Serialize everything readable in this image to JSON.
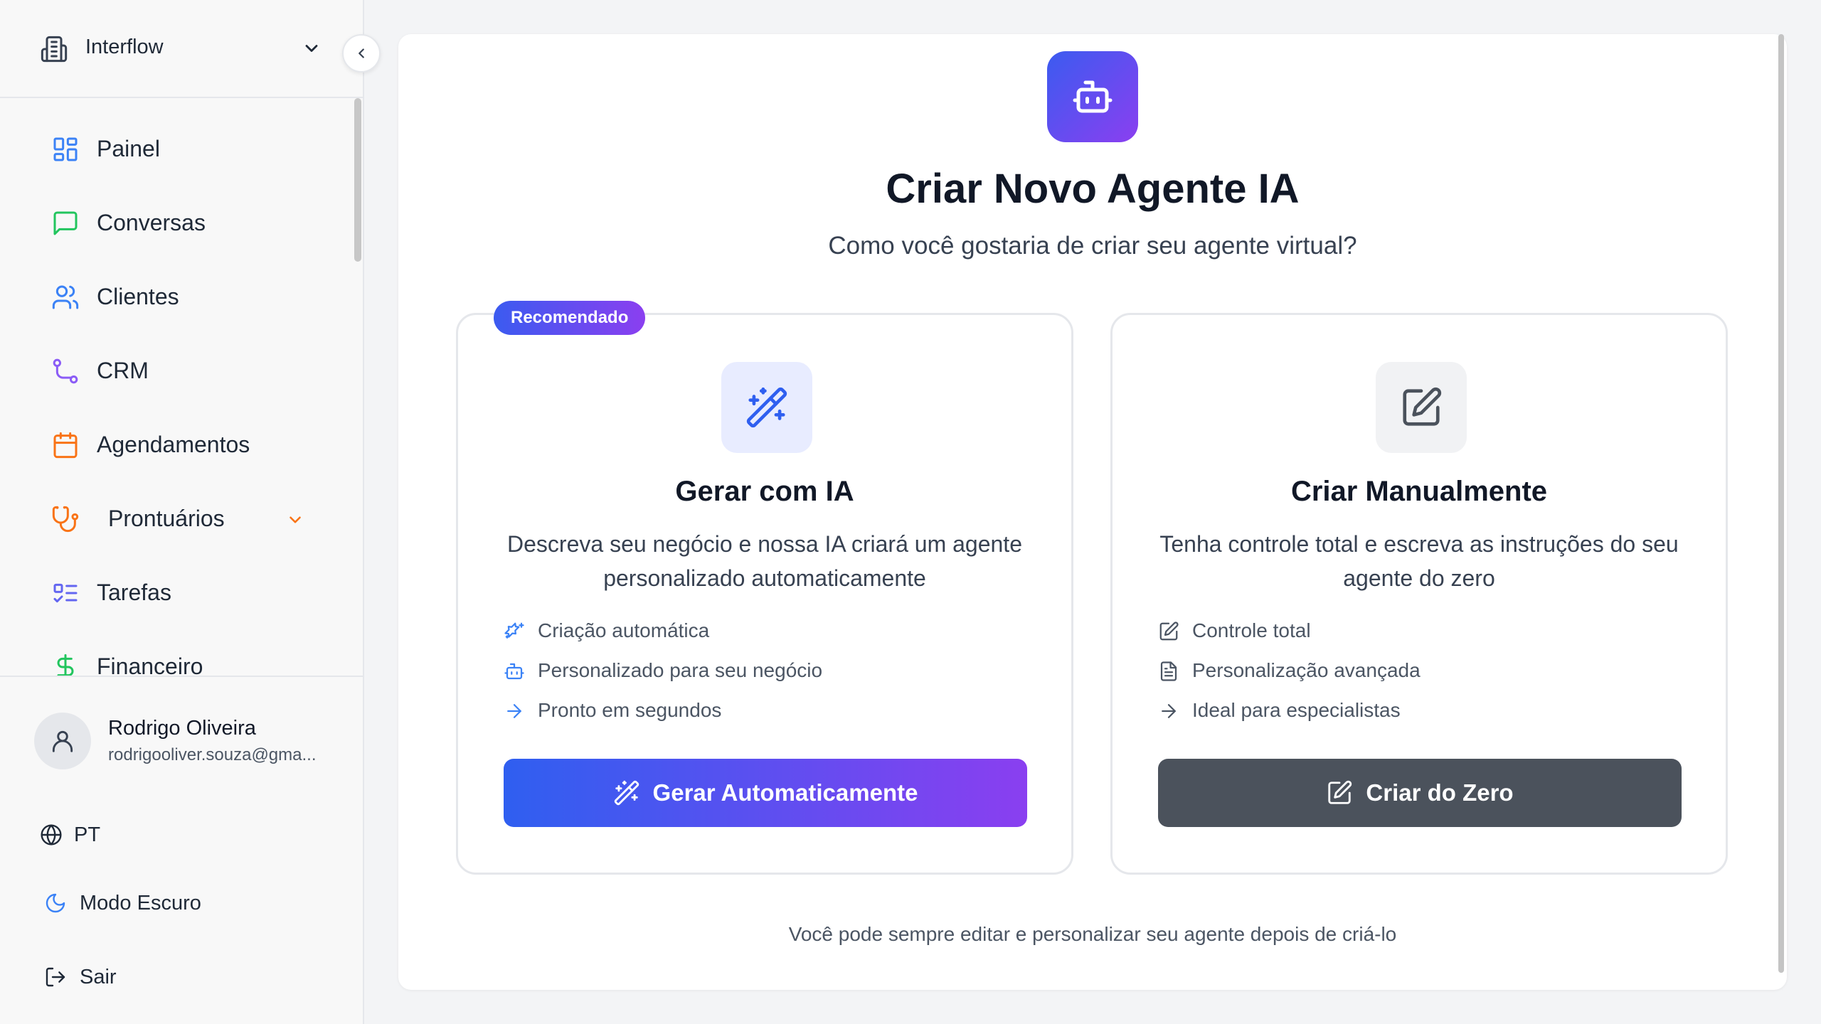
{
  "sidebar": {
    "org_name": "Interflow",
    "nav_items": [
      {
        "label": "Painel",
        "icon": "layout-grid-icon",
        "color": "#3b82f6"
      },
      {
        "label": "Conversas",
        "icon": "message-square-icon",
        "color": "#22c55e"
      },
      {
        "label": "Clientes",
        "icon": "users-icon",
        "color": "#3b82f6"
      },
      {
        "label": "CRM",
        "icon": "workflow-icon",
        "color": "#8b5cf6"
      },
      {
        "label": "Agendamentos",
        "icon": "calendar-icon",
        "color": "#f97316"
      },
      {
        "label": "Prontuários",
        "icon": "stethoscope-icon",
        "color": "#f97316"
      },
      {
        "label": "Tarefas",
        "icon": "list-todo-icon",
        "color": "#6366f1"
      },
      {
        "label": "Financeiro",
        "icon": "dollar-icon",
        "color": "#22c55e"
      }
    ],
    "user": {
      "name": "Rodrigo Oliveira",
      "email": "rodrigooliver.souza@gma..."
    },
    "language": "PT",
    "dark_mode_label": "Modo Escuro",
    "logout_label": "Sair"
  },
  "main": {
    "title": "Criar Novo Agente IA",
    "subtitle": "Como você gostaria de criar seu agente virtual?",
    "cards": [
      {
        "badge": "Recomendado",
        "title": "Gerar com IA",
        "description": "Descreva seu negócio e nossa IA criará um agente personalizado automaticamente",
        "features": [
          "Criação automática",
          "Personalizado para seu negócio",
          "Pronto em segundos"
        ],
        "button": "Gerar Automaticamente"
      },
      {
        "title": "Criar Manualmente",
        "description": "Tenha controle total e escreva as instruções do seu agente do zero",
        "features": [
          "Controle total",
          "Personalização avançada",
          "Ideal para especialistas"
        ],
        "button": "Criar do Zero"
      }
    ],
    "footer_note": "Você pode sempre editar e personalizar seu agente depois de criá-lo"
  },
  "colors": {
    "accent_blue": "#3b5bf0",
    "accent_purple": "#8b3ff0",
    "dark_button": "#4b525c"
  }
}
